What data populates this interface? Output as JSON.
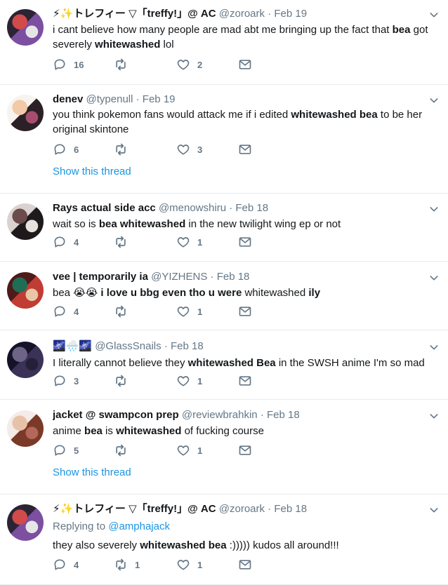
{
  "tweets": [
    {
      "name": "⚡✨トレフィー ▽「treffy!」@ AC",
      "handle": "@zoroark",
      "time": "· Feb 19",
      "replying_label": "",
      "replying_handle": "",
      "text_parts": [
        "i cant believe how many people are mad abt me bringing up the fact that ",
        "bea",
        " got severely ",
        "whitewashed",
        " lol"
      ],
      "reply_count": "16",
      "retweet_count": "",
      "like_count": "2",
      "show_thread": "",
      "avatar_colors": [
        "#2b2434",
        "#7c4fa0",
        "#d14b4b",
        "#e6e6e6"
      ]
    },
    {
      "name": "denev",
      "handle": "@typenull",
      "time": "· Feb 19",
      "replying_label": "",
      "replying_handle": "",
      "text_parts": [
        "you think pokemon fans would attack me if i edited ",
        "whitewashed bea",
        " to be her original skintone",
        "",
        ""
      ],
      "reply_count": "6",
      "retweet_count": "",
      "like_count": "3",
      "show_thread": "Show this thread",
      "avatar_colors": [
        "#f7f3ee",
        "#2a2026",
        "#f2c9a9",
        "#a64d6e"
      ]
    },
    {
      "name": "Rays actual side acc",
      "handle": "@menowshiru",
      "time": "· Feb 18",
      "replying_label": "",
      "replying_handle": "",
      "text_parts": [
        "wait so is ",
        "bea whitewashed",
        " in the new twilight wing ep or not",
        "",
        ""
      ],
      "reply_count": "4",
      "retweet_count": "",
      "like_count": "1",
      "show_thread": "",
      "avatar_colors": [
        "#d9d2cf",
        "#1e1a1c",
        "#6b4b4b",
        "#e7e1de"
      ]
    },
    {
      "name": "vee | temporarily ia",
      "handle": "@YIZHENS",
      "time": "· Feb 18",
      "replying_label": "",
      "replying_handle": "",
      "text_parts": [
        "bea",
        " 😭😭 i love u bbg even tho u were ",
        "whitewashed",
        " ily",
        ""
      ],
      "reply_count": "4",
      "retweet_count": "",
      "like_count": "1",
      "show_thread": "",
      "avatar_colors": [
        "#4e1a1a",
        "#c13c34",
        "#1f6d54",
        "#e9c7a6"
      ]
    },
    {
      "name": "🌌🌧️🌌",
      "handle": "@GlassSnails",
      "time": "· Feb 18",
      "replying_label": "",
      "replying_handle": "",
      "text_parts": [
        "I literally cannot believe they ",
        "whitewashed Bea",
        " in the SWSH anime I'm so mad",
        "",
        ""
      ],
      "reply_count": "3",
      "retweet_count": "",
      "like_count": "1",
      "show_thread": "",
      "avatar_colors": [
        "#15132a",
        "#3a3257",
        "#6d6486",
        "#242038"
      ]
    },
    {
      "name": "jacket @ swampcon prep",
      "handle": "@reviewbrahkin",
      "time": "· Feb 18",
      "replying_label": "",
      "replying_handle": "",
      "text_parts": [
        "anime ",
        "bea",
        " is ",
        "whitewashed",
        " of fucking course"
      ],
      "reply_count": "5",
      "retweet_count": "",
      "like_count": "1",
      "show_thread": "Show this thread",
      "avatar_colors": [
        "#f3ece8",
        "#7a3a27",
        "#e8c2a8",
        "#b4675a"
      ]
    },
    {
      "name": "⚡✨トレフィー ▽「treffy!」@ AC",
      "handle": "@zoroark",
      "time": "· Feb 18",
      "replying_label": "Replying to ",
      "replying_handle": "@amphajack",
      "text_parts": [
        "they also severely ",
        "whitewashed bea",
        " :))))) kudos all around!!!",
        "",
        ""
      ],
      "reply_count": "4",
      "retweet_count": "1",
      "like_count": "1",
      "show_thread": "",
      "avatar_colors": [
        "#2b2434",
        "#7c4fa0",
        "#d14b4b",
        "#e6e6e6"
      ]
    }
  ],
  "colors": {
    "text": "#14171a",
    "muted": "#657786",
    "link": "#1b95e0",
    "divider": "#e6ecf0"
  },
  "icons": {
    "reply": "reply-icon",
    "retweet": "retweet-icon",
    "like": "heart-icon",
    "dm": "envelope-icon",
    "more": "chevron-down-icon"
  }
}
